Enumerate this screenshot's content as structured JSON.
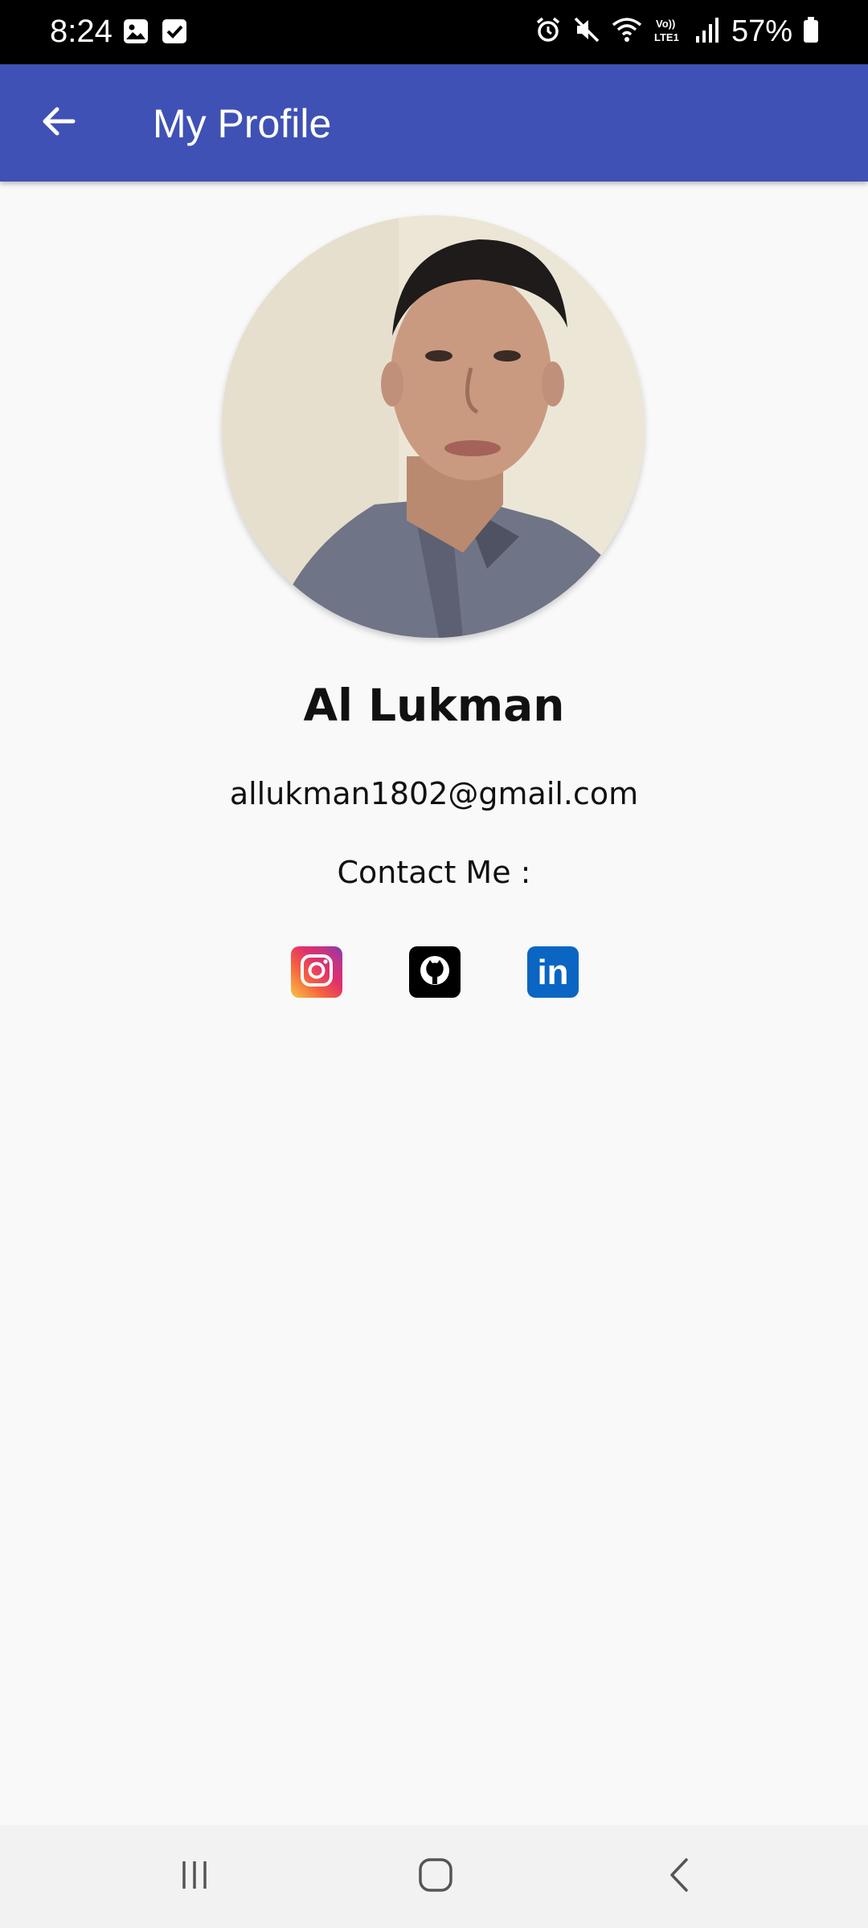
{
  "status_bar": {
    "time": "8:24",
    "battery": "57%",
    "left_icons": [
      "gallery-icon",
      "checkbox-icon"
    ],
    "right_icons": [
      "alarm-icon",
      "mute-icon",
      "wifi-icon",
      "volte-icon",
      "signal-icon",
      "battery-icon"
    ]
  },
  "app_bar": {
    "title": "My Profile",
    "back_icon": "arrow-left-icon",
    "color": "#3f51b5"
  },
  "profile": {
    "name": "Al Lukman",
    "email": "allukman1802@gmail.com",
    "contact_label": "Contact Me :"
  },
  "social": {
    "items": [
      {
        "name": "instagram",
        "icon": "instagram-icon"
      },
      {
        "name": "github",
        "icon": "github-icon"
      },
      {
        "name": "linkedin",
        "icon": "linkedin-icon",
        "text": "in"
      }
    ]
  },
  "nav_bar": {
    "icons": [
      "recent-apps-icon",
      "home-icon",
      "back-icon"
    ]
  }
}
